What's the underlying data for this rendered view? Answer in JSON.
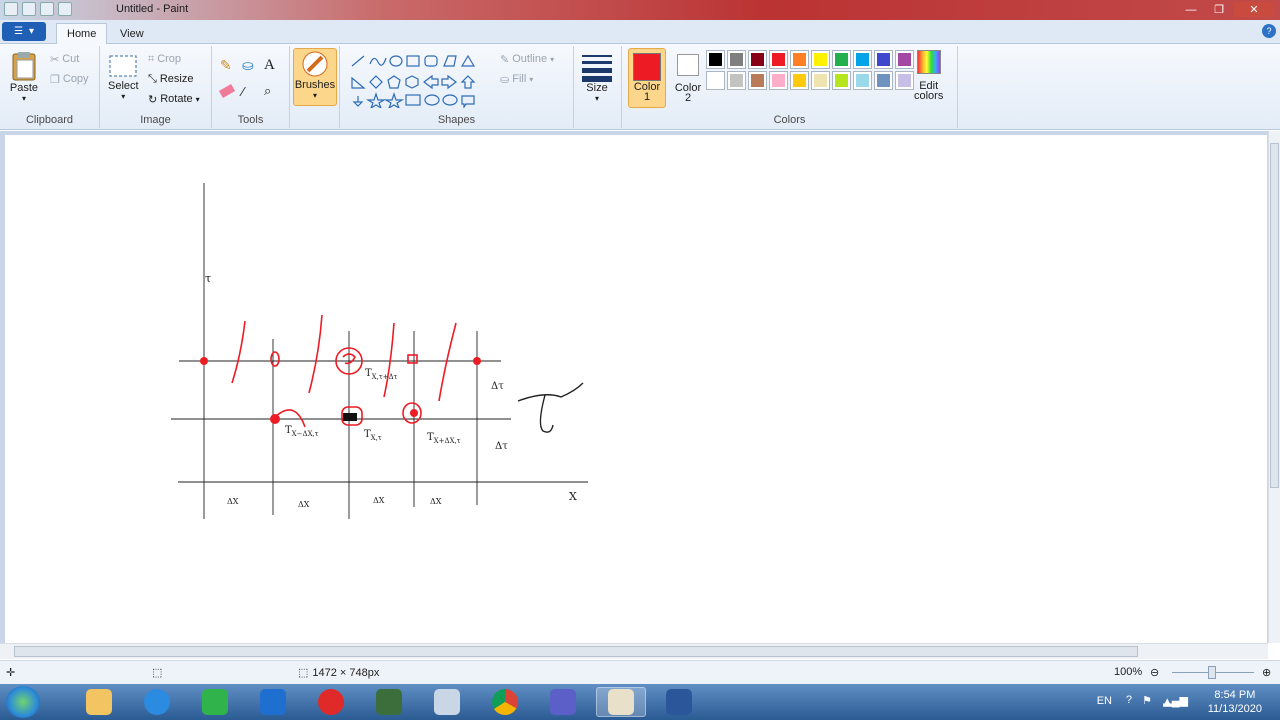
{
  "window": {
    "title": "Untitled - Paint"
  },
  "tabs": [
    {
      "label": "Home"
    },
    {
      "label": "View"
    }
  ],
  "clipboard": {
    "paste": "Paste",
    "cut": "Cut",
    "copy": "Copy",
    "group": "Clipboard"
  },
  "image": {
    "select": "Select",
    "crop": "Crop",
    "resize": "Resize",
    "rotate": "Rotate",
    "group": "Image"
  },
  "tools": {
    "group": "Tools"
  },
  "brushes": {
    "label": "Brushes"
  },
  "shapes": {
    "outline": "Outline",
    "fill": "Fill",
    "group": "Shapes"
  },
  "size": {
    "label": "Size"
  },
  "colors": {
    "color1": "Color",
    "color1_num": "1",
    "color2": "Color",
    "color2_num": "2",
    "edit": "Edit",
    "edit2": "colors",
    "group": "Colors",
    "color1_value": "#ed1c24",
    "color2_value": "#ffffff",
    "palette": [
      "#000000",
      "#7f7f7f",
      "#880015",
      "#ed1c24",
      "#ff7f27",
      "#fff200",
      "#22b14c",
      "#00a2e8",
      "#3f48cc",
      "#a349a4",
      "#ffffff",
      "#c3c3c3",
      "#b97a57",
      "#ffaec9",
      "#ffc90e",
      "#efe4b0",
      "#b5e61d",
      "#99d9ea",
      "#7092be",
      "#c8bfe7"
    ]
  },
  "canvas_text": {
    "tau_axis": "τ",
    "x_axis": "X",
    "dtau1": "Δτ",
    "dtau2": "Δτ",
    "dx1": "ΔX",
    "dx2": "ΔX",
    "dx3": "ΔX",
    "dx4": "ΔX",
    "t_top": "T",
    "t_top_sub": "X,τ+Δτ",
    "t_left": "T",
    "t_left_sub": "X−ΔX,τ",
    "t_mid": "T",
    "t_mid_sub": "X,τ",
    "t_right": "T",
    "t_right_sub": "X+ΔX,τ"
  },
  "status": {
    "size": "1472 × 748px",
    "zoom": "100%"
  },
  "tray": {
    "lang": "EN",
    "time": "8:54 PM",
    "date": "11/13/2020"
  }
}
